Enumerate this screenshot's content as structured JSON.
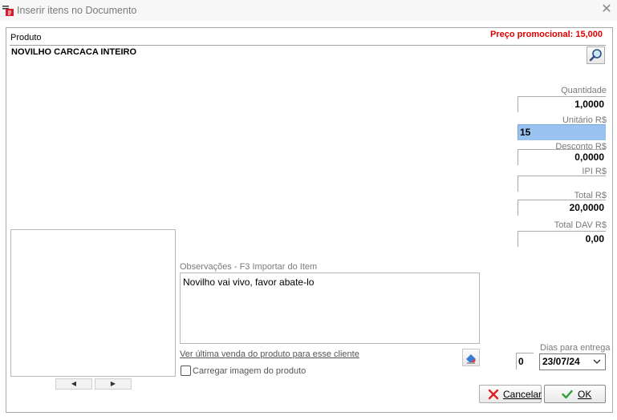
{
  "window": {
    "title": "Inserir itens no Documento",
    "close_glyph": "✕",
    "app_icon": "app-document-icon"
  },
  "produto": {
    "label": "Produto",
    "promo_text": "Preço promocional: 15,000",
    "name": "NOVILHO CARCACA INTEIRO",
    "search_icon": "magnifier-icon"
  },
  "fields": {
    "quantidade": {
      "label": "Quantidade",
      "value": "1,0000"
    },
    "unitario": {
      "label": "Unitário R$",
      "value": "15"
    },
    "desconto": {
      "label": "Desconto R$",
      "value": "0,0000"
    },
    "ipi": {
      "label": "IPI R$",
      "value": ""
    },
    "total": {
      "label": "Total R$",
      "value": "20,0000"
    },
    "total_dav": {
      "label": "Total DAV R$",
      "value": "0,00"
    }
  },
  "image_nav": {
    "prev": "◀",
    "next": "▶"
  },
  "observacoes": {
    "label": "Observações - F3 Importar do Item",
    "value": "Novilho vai vivo, favor abate-lo"
  },
  "link_ultima_venda": "Ver última venda do produto para esse cliente",
  "carregar_imagem": {
    "label": "Carregar imagem do produto",
    "checked": false
  },
  "entrega": {
    "dias_label": "Dias para entrega",
    "dias_value": "0",
    "date_value": "23/07/24"
  },
  "buttons": {
    "cancel_label": "Cancelar",
    "ok_label": "OK"
  },
  "colors": {
    "promo": "#e00000",
    "selected_field": "#99c2f0",
    "cancel_x": "#e02020",
    "ok_check": "#2e9e3a"
  }
}
